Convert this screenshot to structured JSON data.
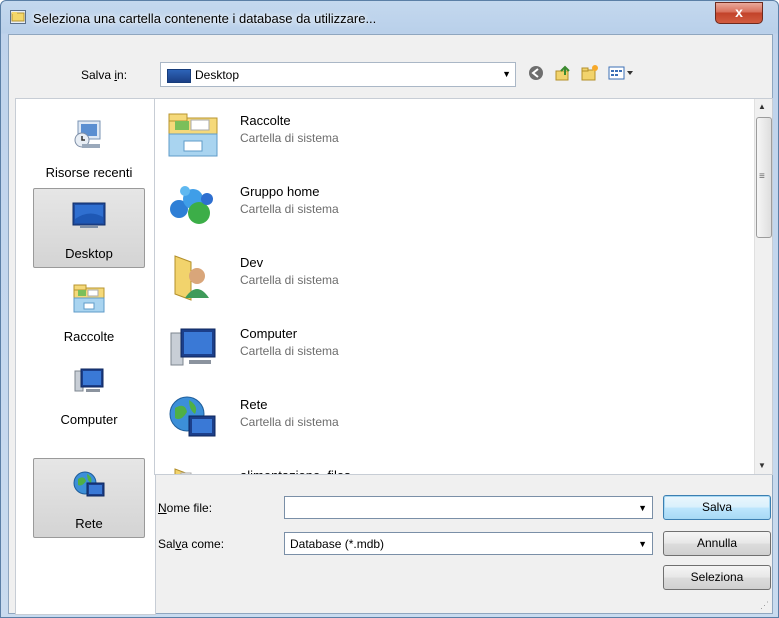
{
  "window": {
    "title": "Seleziona una cartella contenente i database da utilizzare...",
    "close_glyph": "x"
  },
  "toolbar": {
    "save_in_label_pre": "Salva ",
    "save_in_label_u": "i",
    "save_in_label_post": "n:",
    "location": "Desktop",
    "buttons": [
      "back-icon",
      "up-folder-icon",
      "new-folder-icon",
      "views-menu-icon"
    ]
  },
  "places": [
    {
      "label": "Risorse recenti",
      "icon": "recent-places-icon",
      "selected": false
    },
    {
      "label": "Desktop",
      "icon": "desktop-icon",
      "selected": true
    },
    {
      "label": "Raccolte",
      "icon": "libraries-icon",
      "selected": false
    },
    {
      "label": "Computer",
      "icon": "computer-icon",
      "selected": false
    },
    {
      "label": "Rete",
      "icon": "network-icon",
      "selected": false
    }
  ],
  "files": [
    {
      "name": "Raccolte",
      "type": "Cartella di sistema",
      "icon": "libraries-folder-icon"
    },
    {
      "name": "Gruppo home",
      "type": "Cartella di sistema",
      "icon": "homegroup-icon"
    },
    {
      "name": "Dev",
      "type": "Cartella di sistema",
      "icon": "user-folder-icon"
    },
    {
      "name": "Computer",
      "type": "Cartella di sistema",
      "icon": "computer-icon"
    },
    {
      "name": "Rete",
      "type": "Cartella di sistema",
      "icon": "network-globe-icon"
    },
    {
      "name": "alimentazione_files",
      "type": "",
      "icon": "folder-icon"
    }
  ],
  "form": {
    "filename_label_u": "N",
    "filename_label_rest": "ome file:",
    "filename_value": "",
    "savetype_label_pre": "Sal",
    "savetype_label_u": "v",
    "savetype_label_post": "a come:",
    "savetype_value": "Database (*.mdb)"
  },
  "buttons": {
    "save": "Salva",
    "cancel": "Annulla",
    "select": "Seleziona"
  }
}
